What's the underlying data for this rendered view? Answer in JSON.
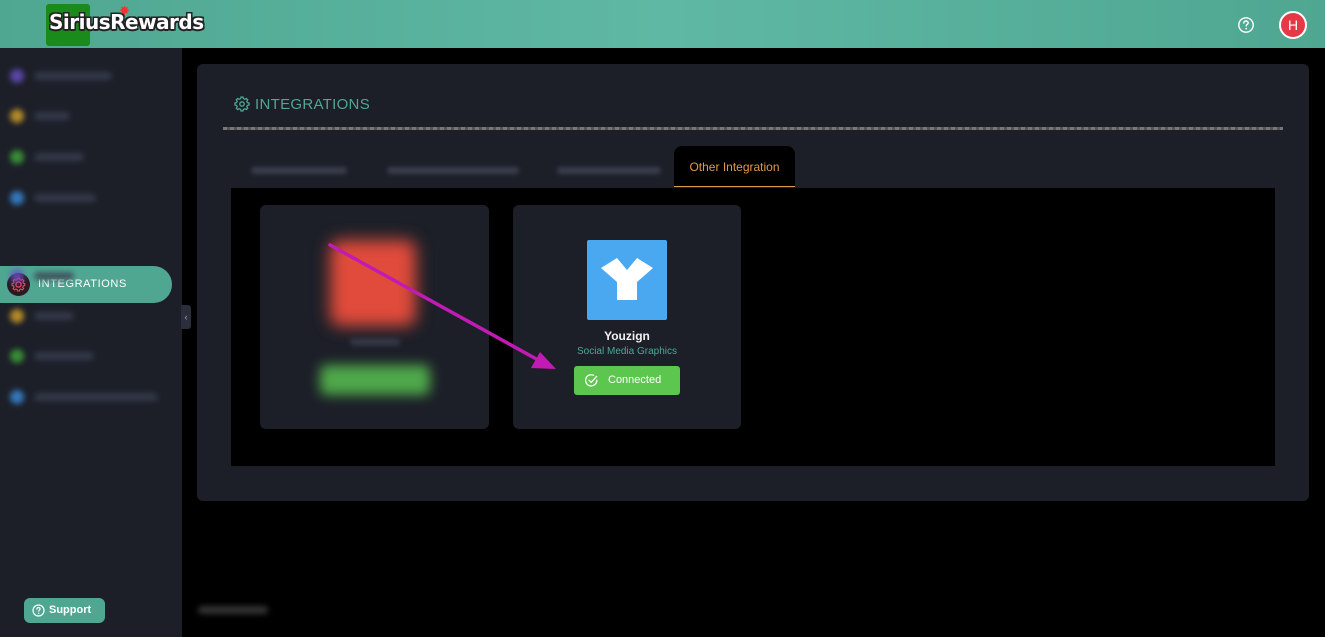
{
  "brand": {
    "logo_text": "SiriusRewards"
  },
  "header": {
    "avatar_letter": "H",
    "help_icon": "question-circle-icon"
  },
  "sidebar": {
    "active_item_label": "INTEGRATIONS",
    "active_item_icon": "gear-icon",
    "support_label": "Support",
    "blurred_item_colors": [
      "#6a4fc8",
      "#d9a42a",
      "#3fa83a",
      "#3a8ee0",
      "#6a4fc8",
      "#d9a42a",
      "#3fa83a",
      "#3a8ee0"
    ]
  },
  "page": {
    "title": "INTEGRATIONS",
    "title_icon": "gear-icon",
    "tabs": [
      {
        "label": "",
        "active": false
      },
      {
        "label": "",
        "active": false
      },
      {
        "label": "",
        "active": false
      },
      {
        "label": "Other Integration",
        "active": true
      }
    ]
  },
  "integrations": [
    {
      "name": "",
      "subtitle": "",
      "status": "",
      "blurred": true
    },
    {
      "name": "Youzign",
      "subtitle": "Social Media Graphics",
      "status": "Connected",
      "blurred": false
    }
  ],
  "colors": {
    "accent": "#4fa792",
    "tab_active": "#e09a4e",
    "connected": "#5cc64e",
    "arrow": "#c21bb5"
  }
}
